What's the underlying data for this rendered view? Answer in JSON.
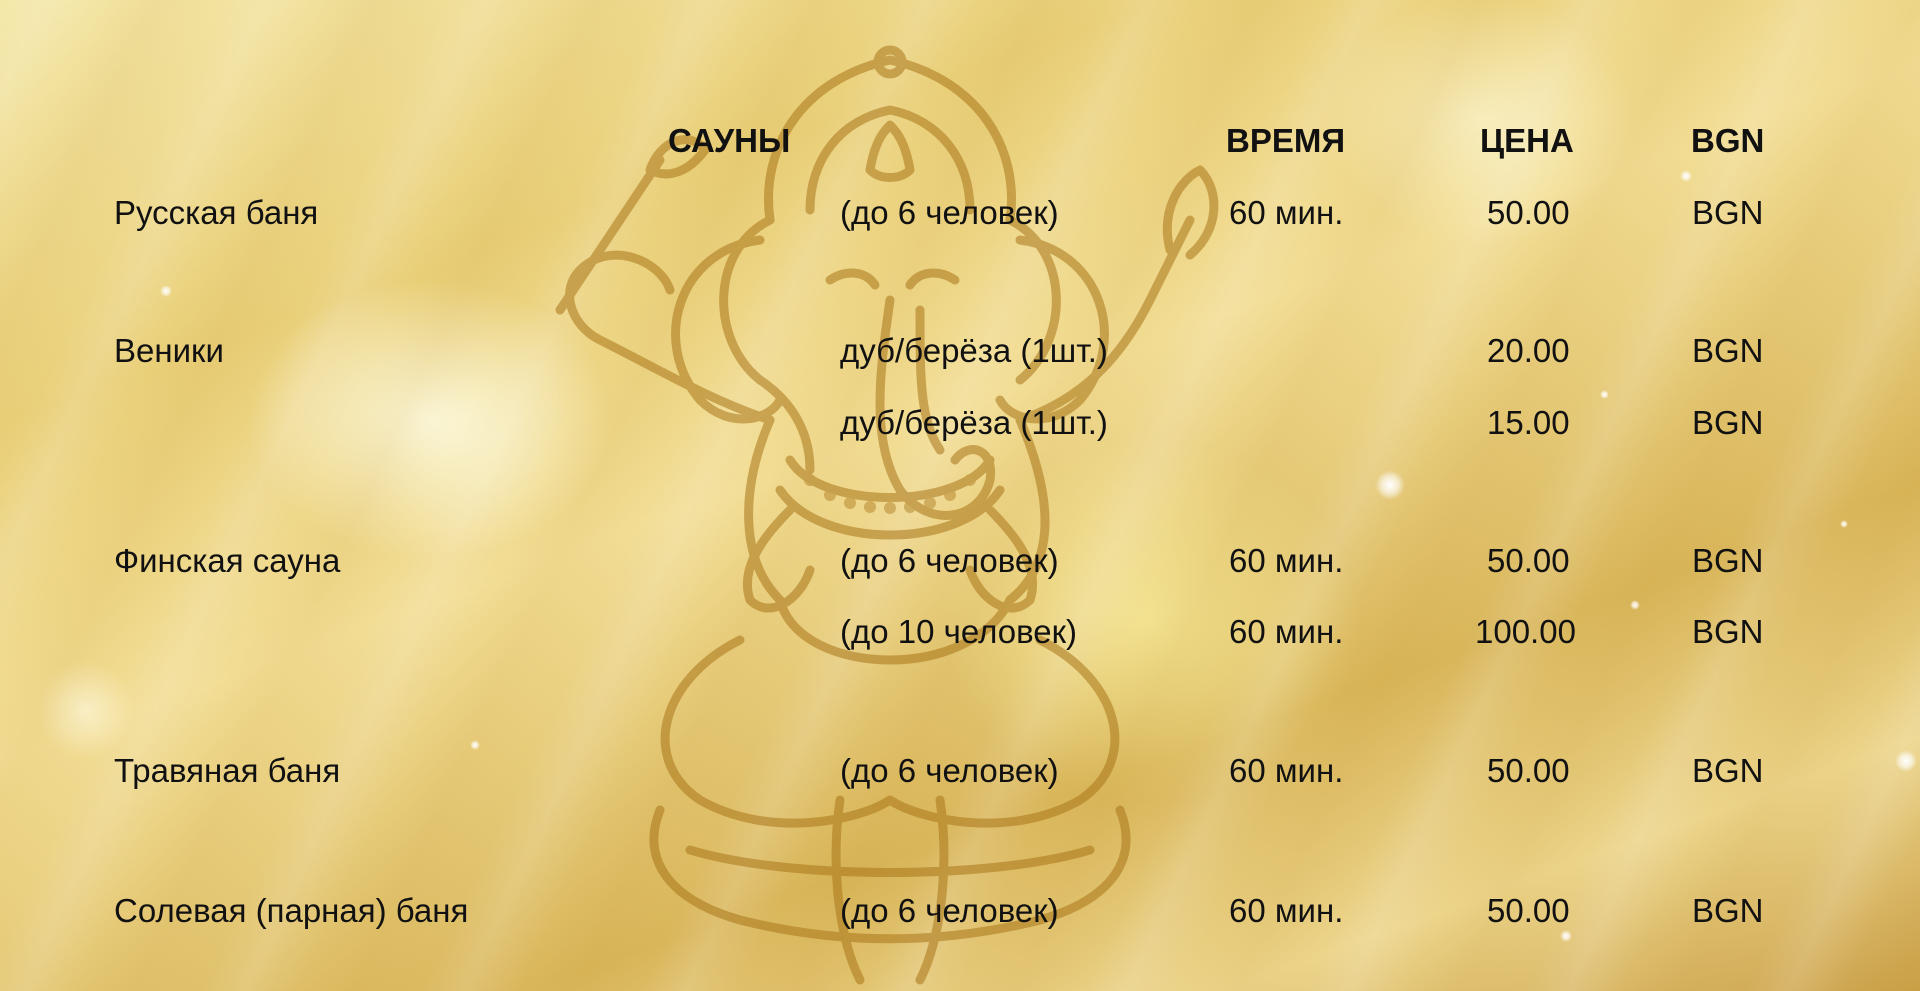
{
  "header": {
    "saunas": "САУНЫ",
    "time": "ВРЕМЯ",
    "price": "ЦЕНА",
    "currency": "BGN"
  },
  "rows": [
    {
      "name": "Русская баня",
      "detail": "(до 6 человек)",
      "time": "60 мин.",
      "price": "50.00",
      "currency": "BGN"
    },
    {
      "name": "Веники",
      "detail": "дуб/берёза (1шт.)",
      "time": "",
      "price": "20.00",
      "currency": "BGN"
    },
    {
      "name": "",
      "detail": "дуб/берёза (1шт.)",
      "time": "",
      "price": "15.00",
      "currency": "BGN"
    },
    {
      "name": "Финская сауна",
      "detail": "(до 6 человек)",
      "time": "60 мин.",
      "price": "50.00",
      "currency": "BGN"
    },
    {
      "name": "",
      "detail": "(до 10 человек)",
      "time": "60 мин.",
      "price": "100.00",
      "currency": "BGN"
    },
    {
      "name": "Травяная баня",
      "detail": "(до 6 человек)",
      "time": "60 мин.",
      "price": "50.00",
      "currency": "BGN"
    },
    {
      "name": "Солевая (парная) баня",
      "detail": "(до 6 человек)",
      "time": "60 мин.",
      "price": "50.00",
      "currency": "BGN"
    }
  ],
  "decor": {
    "background_color": "#e9cf78",
    "illustration": "ganesha-outline-icon"
  }
}
